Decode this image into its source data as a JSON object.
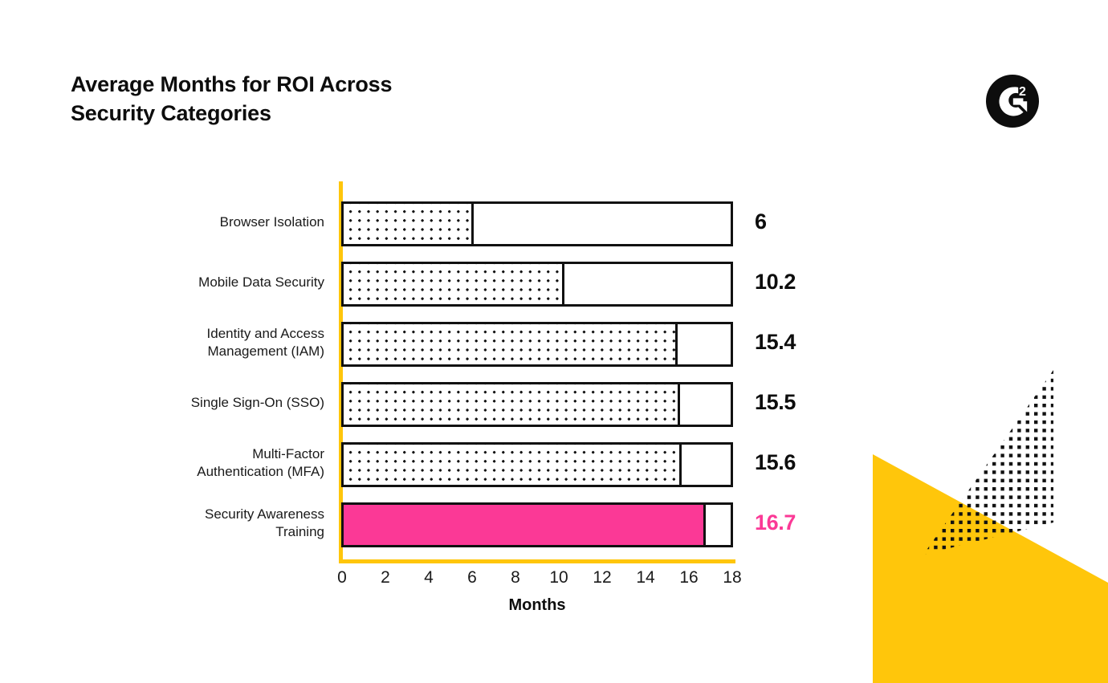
{
  "header": {
    "title": "Average Months for ROI Across\nSecurity Categories",
    "logo_alt": "G2",
    "logo_letter": "G",
    "logo_superscript": "2"
  },
  "colors": {
    "accent_yellow": "#FFC60B",
    "highlight_pink": "#FB3996",
    "ink": "#111111",
    "background": "#FFFFFF"
  },
  "chart_data": {
    "type": "bar",
    "orientation": "horizontal",
    "title": "Average Months for ROI Across Security Categories",
    "xlabel": "Months",
    "ylabel": "",
    "xlim": [
      0,
      18
    ],
    "xticks": [
      "0",
      "2",
      "4",
      "6",
      "8",
      "10",
      "12",
      "14",
      "16",
      "18"
    ],
    "grid": false,
    "legend": false,
    "categories": [
      "Browser Isolation",
      "Mobile Data Security",
      "Identity and Access\nManagement (IAM)",
      "Single Sign-On (SSO)",
      "Multi-Factor\nAuthentication (MFA)",
      "Security Awareness\nTraining"
    ],
    "values": [
      6,
      10.2,
      15.4,
      15.5,
      15.6,
      16.7
    ],
    "value_labels": [
      "6",
      "10.2",
      "15.4",
      "15.5",
      "15.6",
      "16.7"
    ],
    "fill_styles": [
      "dotted",
      "dotted",
      "dotted",
      "dotted",
      "dotted",
      "solid"
    ],
    "highlight_index": 5
  }
}
